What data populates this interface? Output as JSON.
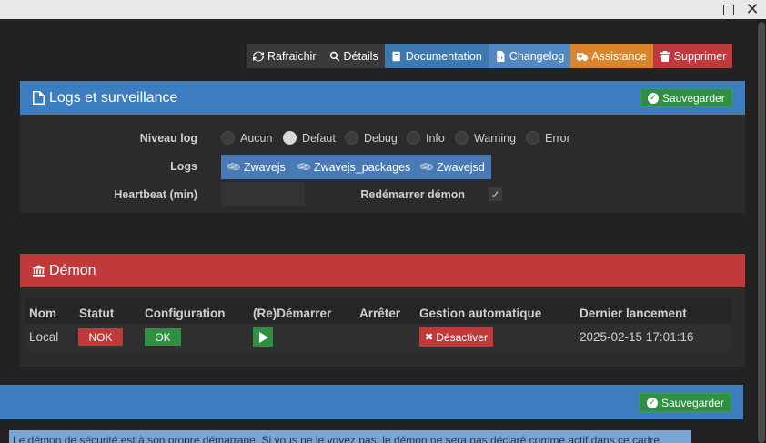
{
  "window": {
    "maximize_icon": "maximize-icon",
    "close_icon": "close-icon"
  },
  "actions": [
    {
      "label": "Rafraichir",
      "icon": "refresh-icon"
    },
    {
      "label": "Détails",
      "icon": "search-icon"
    },
    {
      "label": "Documentation",
      "icon": "book-icon"
    },
    {
      "label": "Changelog",
      "icon": "file-code-icon"
    },
    {
      "label": "Assistance",
      "icon": "ambulance-icon"
    },
    {
      "label": "Supprimer",
      "icon": "trash-icon"
    }
  ],
  "logs_panel": {
    "title": "Logs et surveillance",
    "save_label": "Sauvegarder",
    "niveau_log_label": "Niveau log",
    "levels": [
      "Aucun",
      "Defaut",
      "Debug",
      "Info",
      "Warning",
      "Error"
    ],
    "selected_level": "Defaut",
    "logs_label": "Logs",
    "log_buttons": [
      "Zwavejs",
      "Zwavejs_packages",
      "Zwavejsd"
    ],
    "heartbeat_label": "Heartbeat (min)",
    "heartbeat_value": "",
    "restart_label": "Redémarrer démon",
    "restart_checked": true
  },
  "demon_panel": {
    "title": "Démon",
    "columns": [
      "Nom",
      "Statut",
      "Configuration",
      "(Re)Démarrer",
      "Arrêter",
      "Gestion automatique",
      "Dernier lancement"
    ],
    "row": {
      "nom": "Local",
      "statut": "NOK",
      "configuration": "OK",
      "gestion_label": "Désactiver",
      "dernier_lancement": "2025-02-15 17:01:16"
    }
  },
  "bottom_panel": {
    "save_label": "Sauvegarder",
    "info_text": "Le démon de sécurité est à son propre démarrage. Si vous ne le voyez pas, le démon ne sera pas déclaré comme actif dans ce cadre"
  },
  "colors": {
    "blue": "#3b7dbf",
    "red": "#c2393c",
    "green": "#2f8f43",
    "orange": "#d9852e"
  }
}
